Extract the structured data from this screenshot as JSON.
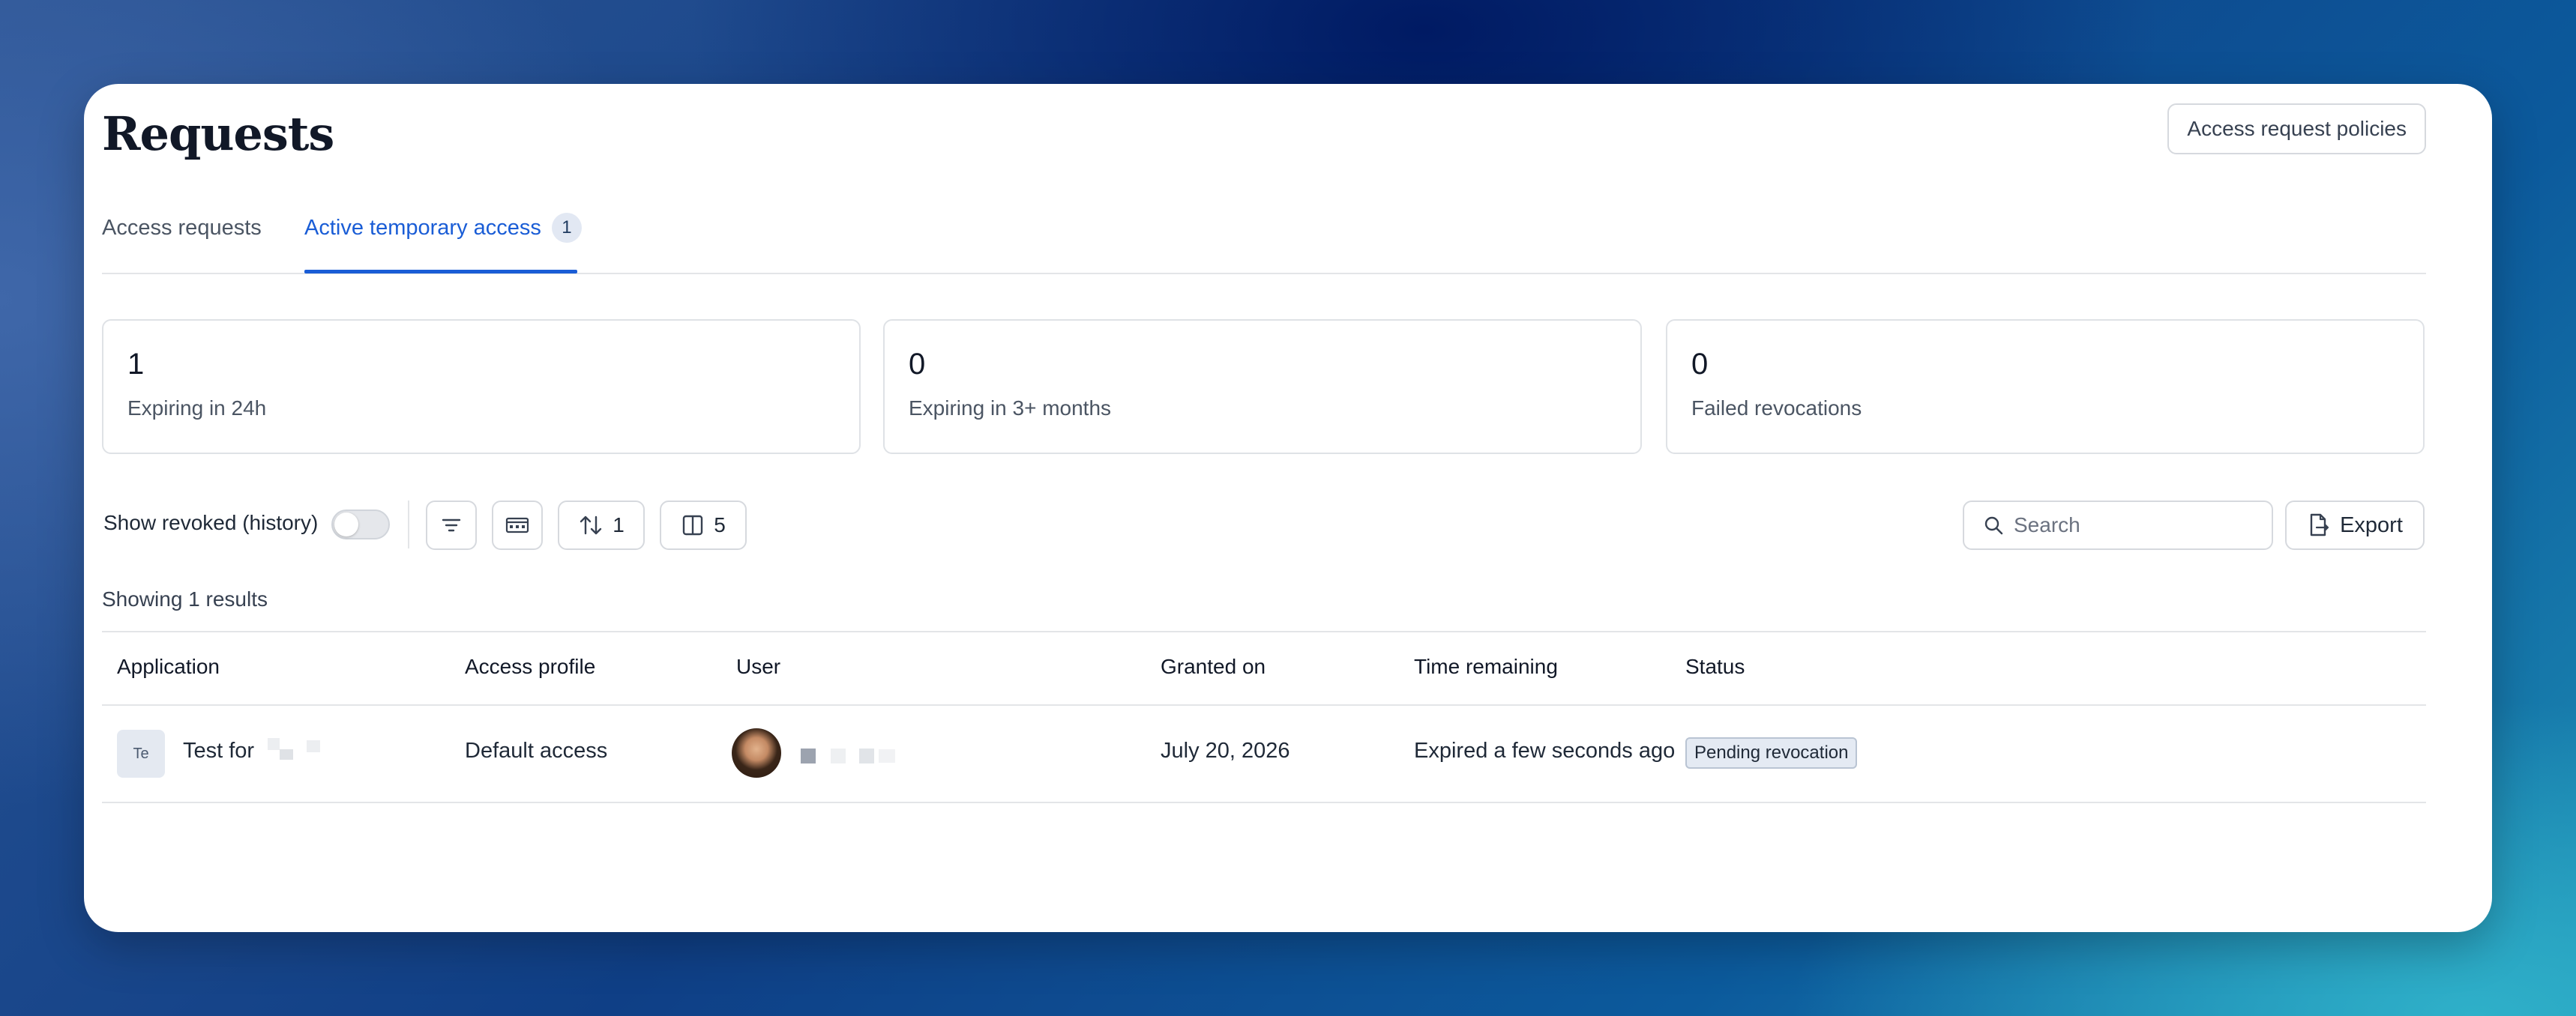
{
  "header": {
    "title": "Requests",
    "policies_button": "Access request policies"
  },
  "tabs": [
    {
      "label": "Access requests",
      "active": false
    },
    {
      "label": "Active temporary access",
      "active": true,
      "badge": "1"
    }
  ],
  "stats": [
    {
      "value": "1",
      "label": "Expiring in 24h"
    },
    {
      "value": "0",
      "label": "Expiring in 3+ months"
    },
    {
      "value": "0",
      "label": "Failed revocations"
    }
  ],
  "toolbar": {
    "show_revoked_label": "Show revoked (history)",
    "show_revoked_on": false,
    "filter_icon": "filter-icon",
    "group_icon": "group-icon",
    "sort_count": "1",
    "columns_count": "5",
    "search_placeholder": "Search",
    "export_label": "Export"
  },
  "results_text": "Showing 1 results",
  "table": {
    "columns": [
      "Application",
      "Access profile",
      "User",
      "Granted on",
      "Time remaining",
      "Status"
    ],
    "rows": [
      {
        "app_icon_text": "Te",
        "application": "Test for",
        "access_profile": "Default access",
        "granted_on": "July 20, 2026",
        "time_remaining": "Expired a few seconds ago",
        "status": "Pending revocation"
      }
    ]
  },
  "colors": {
    "accent": "#1a5dd6",
    "border": "#d6d9de",
    "status_bg": "#e4eaf3"
  }
}
